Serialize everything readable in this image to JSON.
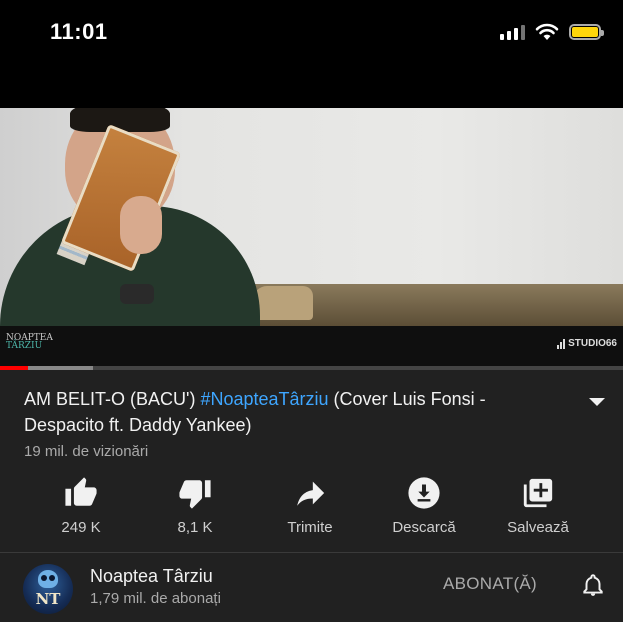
{
  "status_bar": {
    "time": "11:01",
    "icons": [
      "cellular-signal-icon",
      "wifi-icon",
      "battery-icon"
    ],
    "battery_color": "#ffd60a"
  },
  "video": {
    "watermark_left": [
      "NOAPTEA",
      "TÂRZIU"
    ],
    "watermark_right": "STUDIO66",
    "progress_played": 0.045,
    "progress_buffered": 0.15,
    "progress_color": "#ff0000"
  },
  "details": {
    "title_prefix": "AM BELIT-O (BACU') ",
    "title_hashtag": "#NoapteaTârziu",
    "title_suffix": " (Cover Luis Fonsi - Despacito ft. Daddy Yankee)",
    "hashtag_color": "#3ea6ff",
    "views": "19 mil. de vizionări",
    "expand_icon": "chevron-down-icon"
  },
  "actions": [
    {
      "icon": "thumbs-up-icon",
      "label": "249 K"
    },
    {
      "icon": "thumbs-down-icon",
      "label": "8,1 K"
    },
    {
      "icon": "share-icon",
      "label": "Trimite"
    },
    {
      "icon": "download-icon",
      "label": "Descarcă"
    },
    {
      "icon": "add-to-playlist-icon",
      "label": "Salvează"
    }
  ],
  "channel": {
    "avatar_text": "NT",
    "name": "Noaptea Târziu",
    "subscribers": "1,79 mil. de abonați",
    "subscribe_state": "ABONAT(Ă)",
    "bell_icon": "bell-icon"
  }
}
